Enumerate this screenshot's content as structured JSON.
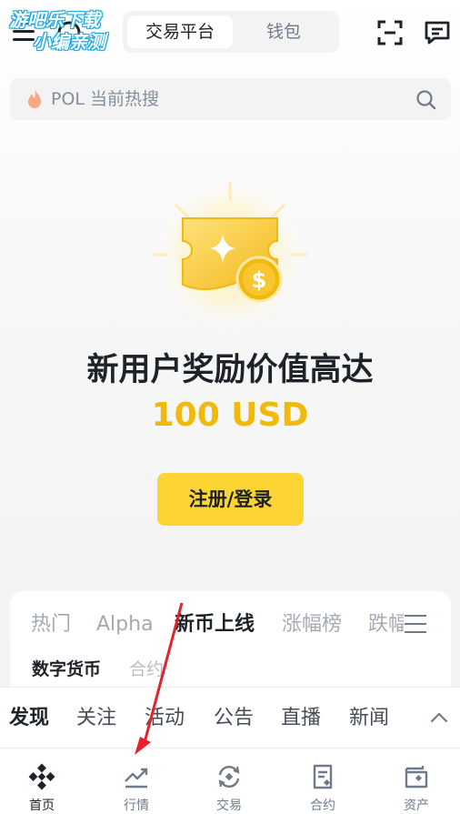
{
  "watermark": {
    "line1": "游吧乐下载",
    "line2": "小编亲测"
  },
  "header": {
    "segments": [
      {
        "label": "交易平台",
        "active": true
      },
      {
        "label": "钱包",
        "active": false
      }
    ],
    "icons": [
      "menu-icon",
      "support-icon",
      "scan-icon",
      "message-icon"
    ]
  },
  "search": {
    "placeholder": "POL 当前热搜",
    "icon": "search-icon",
    "prefix_icon": "fire-icon"
  },
  "hero": {
    "title": "新用户奖励价值高达",
    "amount": "100 USD",
    "cta_label": "注册/登录"
  },
  "market": {
    "tabs": [
      {
        "label": "热门",
        "active": false
      },
      {
        "label": "Alpha",
        "active": false
      },
      {
        "label": "新币上线",
        "active": true
      },
      {
        "label": "涨幅榜",
        "active": false
      },
      {
        "label": "跌幅",
        "active": false
      }
    ],
    "subtabs": [
      {
        "label": "数字货币",
        "active": true
      },
      {
        "label": "合约",
        "active": false
      }
    ]
  },
  "discover": {
    "tabs": [
      {
        "label": "发现",
        "active": true
      },
      {
        "label": "关注",
        "active": false
      },
      {
        "label": "活动",
        "active": false
      },
      {
        "label": "公告",
        "active": false
      },
      {
        "label": "直播",
        "active": false
      },
      {
        "label": "新闻",
        "active": false
      }
    ]
  },
  "bottom_nav": [
    {
      "label": "首页",
      "icon": "binance-logo-icon",
      "active": true
    },
    {
      "label": "行情",
      "icon": "chart-trend-icon",
      "active": false
    },
    {
      "label": "交易",
      "icon": "trade-exchange-icon",
      "active": false
    },
    {
      "label": "合约",
      "icon": "futures-document-icon",
      "active": false
    },
    {
      "label": "资产",
      "icon": "wallet-icon",
      "active": false
    }
  ],
  "colors": {
    "accent_yellow": "#fcd535",
    "amount_gold": "#f0b90b",
    "text_primary": "#1e2329",
    "text_secondary": "#707a8a",
    "annotation_red": "#e8202a"
  }
}
